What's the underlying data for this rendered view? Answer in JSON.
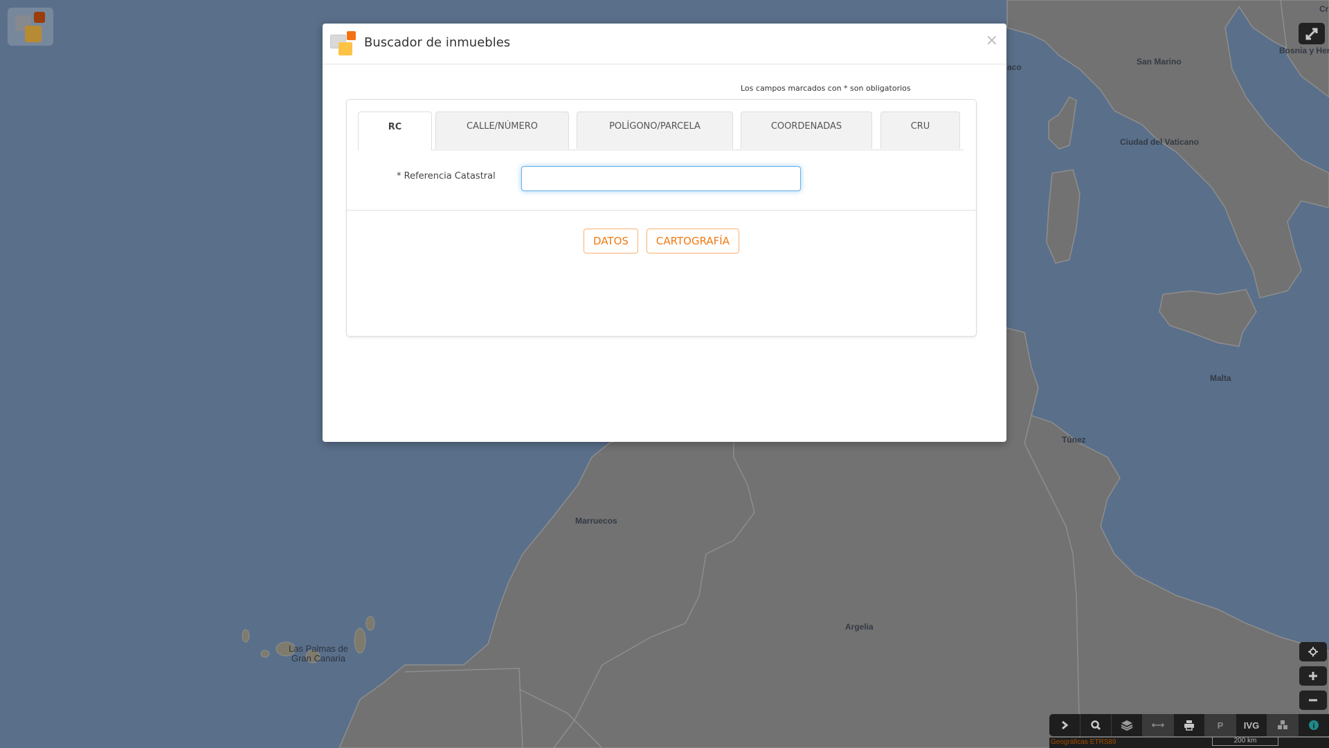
{
  "map": {
    "labels": [
      {
        "id": "san-marino",
        "text": "San Marino"
      },
      {
        "id": "ciudad-del-vaticano",
        "text": "Ciudad del Vaticano"
      },
      {
        "id": "monaco-partial",
        "text": "aco"
      },
      {
        "id": "bosnia-partial",
        "text": "Bosnia y Her"
      },
      {
        "id": "croacia-partial",
        "text": "Cr"
      },
      {
        "id": "malta",
        "text": "Malta"
      },
      {
        "id": "tunez",
        "text": "Túnez"
      },
      {
        "id": "marruecos",
        "text": "Marruecos"
      },
      {
        "id": "argelia",
        "text": "Argelia"
      },
      {
        "id": "las-palmas",
        "text": "Las Palmas de Gran Canaria"
      }
    ],
    "colors": {
      "sea": "#5a6f8a",
      "land": "#727272",
      "border": "#8e8e8e"
    }
  },
  "controls": {
    "fullscreen_icon": "expand-icon",
    "locate_icon": "crosshair-icon",
    "zoom_in_icon": "plus-icon",
    "zoom_out_icon": "minus-icon"
  },
  "toolbar": {
    "items": [
      {
        "name": "expand-toolbar",
        "icon": "chevron-right-icon",
        "label": "›"
      },
      {
        "name": "search",
        "icon": "search-icon",
        "label": ""
      },
      {
        "name": "layers",
        "icon": "layers-icon",
        "label": ""
      },
      {
        "name": "measure",
        "icon": "measure-icon",
        "label": "⟷"
      },
      {
        "name": "print",
        "icon": "print-icon",
        "label": ""
      },
      {
        "name": "parcel",
        "icon": "parcel-pin-icon",
        "label": "P"
      },
      {
        "name": "ivg",
        "icon": "ivg-icon",
        "label": "IVG"
      },
      {
        "name": "3d",
        "icon": "cubes-icon",
        "label": ""
      },
      {
        "name": "info",
        "icon": "info-icon",
        "label": "i"
      }
    ],
    "crs": "Geográficas ETRS89",
    "scale": "200 km"
  },
  "dialog": {
    "title": "Buscador de inmuebles",
    "close_label": "×",
    "required_note": "Los campos marcados con * son obligatorios",
    "tabs": [
      {
        "label": "RC",
        "active": true
      },
      {
        "label": "CALLE/NÚMERO",
        "active": false
      },
      {
        "label": "POLÍGONO/PARCELA",
        "active": false
      },
      {
        "label": "COORDENADAS",
        "active": false
      },
      {
        "label": "CRU",
        "active": false
      }
    ],
    "field": {
      "label": "* Referencia Catastral",
      "value": "",
      "placeholder": ""
    },
    "buttons": {
      "datos": "DATOS",
      "cartografia": "CARTOGRAFÍA"
    },
    "accent": "#f07a14"
  }
}
